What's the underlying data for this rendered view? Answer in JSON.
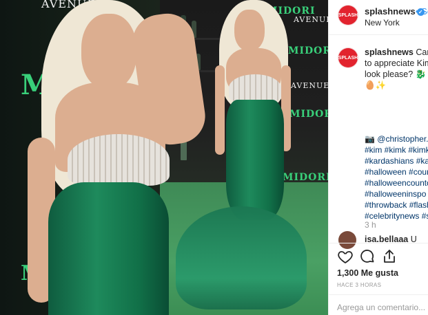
{
  "photo": {
    "brand_text": "MIDORI",
    "brand_text_right_top": "MIDORI",
    "brand_text_right_mid": "MIDORI",
    "brand_text_right_low": "MIDORI",
    "brand_text_right_bottom": "MIDORI",
    "avenue_text": "AVENUE",
    "avenue_text_mid": "AVENUE",
    "avenue_text_top_left": "AVENUE",
    "brand_partial_bottom": "M"
  },
  "header": {
    "username": "splashnews",
    "follow_label": "Se",
    "location": "New York",
    "avatar_text": "SPLASH"
  },
  "caption": {
    "username": "splashnews",
    "lines": [
      "Can",
      "to appreciate Kim's",
      "look please? 🐉 Thi",
      "🥚✨"
    ]
  },
  "credits": {
    "photo_credit": "📷 @christopher.p",
    "hashtag_lines": [
      "#kim #kimk #kimka",
      "#kardashians #kard",
      "#halloween #count",
      "#halloweencountd",
      "#halloweeninspo #",
      "#throwback #flashl",
      "#celebritynews #sp"
    ],
    "timestamp": "3 h"
  },
  "comment": {
    "username": "isa.bellaaa",
    "text": "U"
  },
  "actions": {
    "likes": "1,300 Me gusta",
    "ago": "HACE 3 HORAS",
    "comment_placeholder": "Agrega un comentario..."
  },
  "colors": {
    "accent_link": "#3897f0",
    "hashtag": "#003569",
    "brand_red": "#e2232e",
    "brand_green": "#39d07a"
  }
}
